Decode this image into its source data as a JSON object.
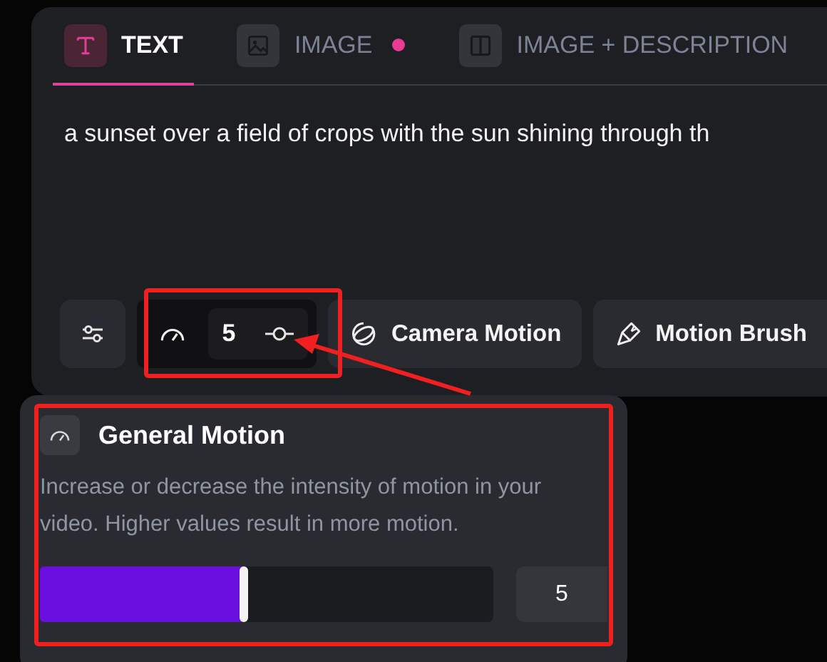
{
  "tabs": [
    {
      "label": "TEXT",
      "selected": true,
      "dot": false
    },
    {
      "label": "IMAGE",
      "selected": false,
      "dot": true
    },
    {
      "label": "IMAGE + DESCRIPTION",
      "selected": false,
      "dot": false
    }
  ],
  "prompt": {
    "value": "a sunset over a field of crops with the sun shining through th"
  },
  "toolbar": {
    "motion_value": "5",
    "buttons": [
      "Camera Motion",
      "Motion Brush"
    ]
  },
  "popup": {
    "title": "General Motion",
    "description": "Increase or decrease the intensity of motion in your video. Higher values result in more motion.",
    "slider": {
      "level": 0.45
    },
    "value": "5"
  }
}
